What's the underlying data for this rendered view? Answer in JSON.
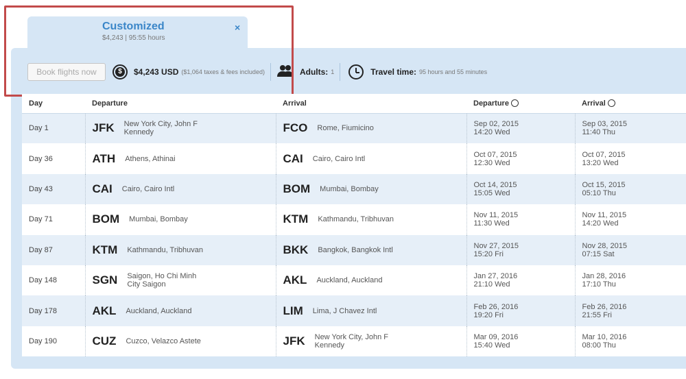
{
  "tab": {
    "title": "Customized",
    "subtitle": "$4,243 | 95:55 hours",
    "close": "×"
  },
  "toolbar": {
    "book_label": "Book flights now",
    "price": "$4,243 USD",
    "taxes": "($1,064 taxes & fees included)",
    "adults_label": "Adults:",
    "adults_value": "1",
    "travel_label": "Travel time:",
    "travel_value": "95 hours and 55 minutes"
  },
  "table": {
    "headers": [
      "Day",
      "Departure",
      "Arrival",
      "Departure",
      "Arrival"
    ],
    "rows": [
      {
        "day": "Day 1",
        "dep_code": "JFK",
        "dep_city": "New York City, John F Kennedy",
        "arr_code": "FCO",
        "arr_city": "Rome, Fiumicino",
        "dep_date": "Sep 02, 2015",
        "dep_time": "14:20 Wed",
        "arr_date": "Sep 03, 2015",
        "arr_time": "11:40 Thu"
      },
      {
        "day": "Day 36",
        "dep_code": "ATH",
        "dep_city": "Athens, Athinai",
        "arr_code": "CAI",
        "arr_city": "Cairo, Cairo Intl",
        "dep_date": "Oct 07, 2015",
        "dep_time": "12:30 Wed",
        "arr_date": "Oct 07, 2015",
        "arr_time": "13:20 Wed"
      },
      {
        "day": "Day 43",
        "dep_code": "CAI",
        "dep_city": "Cairo, Cairo Intl",
        "arr_code": "BOM",
        "arr_city": "Mumbai, Bombay",
        "dep_date": "Oct 14, 2015",
        "dep_time": "15:05 Wed",
        "arr_date": "Oct 15, 2015",
        "arr_time": "05:10 Thu"
      },
      {
        "day": "Day 71",
        "dep_code": "BOM",
        "dep_city": "Mumbai, Bombay",
        "arr_code": "KTM",
        "arr_city": "Kathmandu, Tribhuvan",
        "dep_date": "Nov 11, 2015",
        "dep_time": "11:30 Wed",
        "arr_date": "Nov 11, 2015",
        "arr_time": "14:20 Wed"
      },
      {
        "day": "Day 87",
        "dep_code": "KTM",
        "dep_city": "Kathmandu, Tribhuvan",
        "arr_code": "BKK",
        "arr_city": "Bangkok, Bangkok Intl",
        "dep_date": "Nov 27, 2015",
        "dep_time": "15:20 Fri",
        "arr_date": "Nov 28, 2015",
        "arr_time": "07:15 Sat"
      },
      {
        "day": "Day 148",
        "dep_code": "SGN",
        "dep_city": "Saigon, Ho Chi Minh City Saigon",
        "arr_code": "AKL",
        "arr_city": "Auckland, Auckland",
        "dep_date": "Jan 27, 2016",
        "dep_time": "21:10 Wed",
        "arr_date": "Jan 28, 2016",
        "arr_time": "17:10 Thu"
      },
      {
        "day": "Day 178",
        "dep_code": "AKL",
        "dep_city": "Auckland, Auckland",
        "arr_code": "LIM",
        "arr_city": "Lima, J Chavez Intl",
        "dep_date": "Feb 26, 2016",
        "dep_time": "19:20 Fri",
        "arr_date": "Feb 26, 2016",
        "arr_time": "21:55 Fri"
      },
      {
        "day": "Day 190",
        "dep_code": "CUZ",
        "dep_city": "Cuzco, Velazco Astete",
        "arr_code": "JFK",
        "arr_city": "New York City, John F Kennedy",
        "dep_date": "Mar 09, 2016",
        "dep_time": "15:40 Wed",
        "arr_date": "Mar 10, 2016",
        "arr_time": "08:00 Thu"
      }
    ]
  }
}
